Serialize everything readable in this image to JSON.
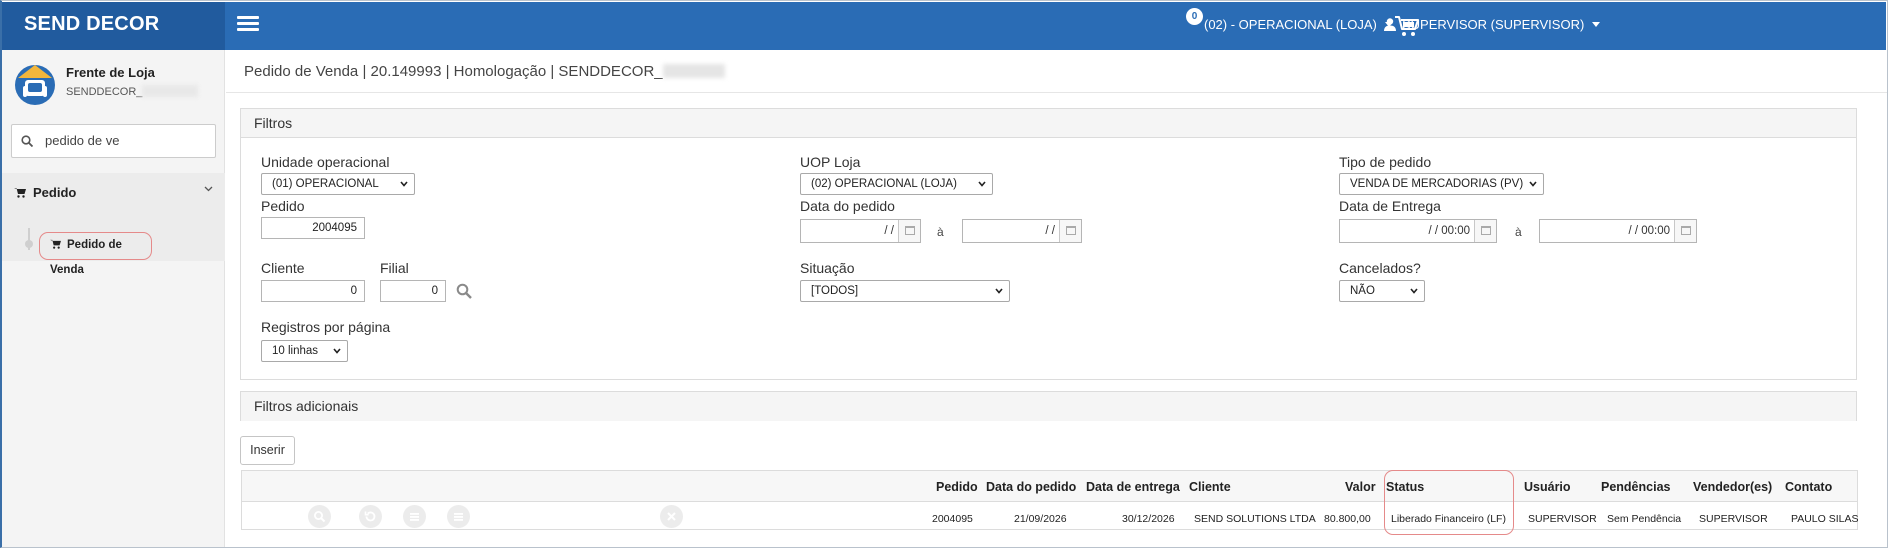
{
  "header": {
    "brand": "SEND DECOR",
    "cart_count": "0",
    "store_selector": "(02) - OPERACIONAL (LOJA)",
    "user_menu": "SUPERVISOR (SUPERVISOR)"
  },
  "sidebar": {
    "app_title": "Frente de Loja",
    "app_subtitle": "SENDDECOR_",
    "search_value": "pedido de ve",
    "menu_group": "Pedido",
    "menu_item": "Pedido de Venda"
  },
  "breadcrumb": "Pedido de Venda | 20.149993 | Homologação | SENDDECOR_",
  "filters": {
    "title": "Filtros",
    "unidade_label": "Unidade operacional",
    "unidade_value": "(01) OPERACIONAL",
    "uop_label": "UOP Loja",
    "uop_value": "(02) OPERACIONAL (LOJA)",
    "tipo_label": "Tipo de pedido",
    "tipo_value": "VENDA DE MERCADORIAS (PV)",
    "pedido_label": "Pedido",
    "pedido_value": "2004095",
    "data_pedido_label": "Data do pedido",
    "data_pedido_from": "/ /",
    "data_pedido_to": "/ /",
    "data_entrega_label": "Data de Entrega",
    "data_entrega_from": "/ /   00:00",
    "data_entrega_to": "/ /   00:00",
    "range_sep": "à",
    "cliente_label": "Cliente",
    "cliente_value": "0",
    "filial_label": "Filial",
    "filial_value": "0",
    "situacao_label": "Situação",
    "situacao_value": "[TODOS]",
    "cancelados_label": "Cancelados?",
    "cancelados_value": "NÃO",
    "registros_label": "Registros por página",
    "registros_value": "10 linhas"
  },
  "additional_filters": {
    "title": "Filtros adicionais"
  },
  "actions": {
    "insert_label": "Inserir"
  },
  "table": {
    "columns": [
      "Pedido",
      "Data do pedido",
      "Data de entrega",
      "Cliente",
      "Valor",
      "Status",
      "Usuário",
      "Pendências",
      "Vendedor(es)",
      "Contato"
    ],
    "rows": [
      [
        "2004095",
        "21/09/2026",
        "30/12/2026",
        "SEND SOLUTIONS LTDA",
        "80.800,00",
        "Liberado Financeiro (LF)",
        "SUPERVISOR",
        "Sem Pendência",
        "SUPERVISOR",
        "PAULO SILAS"
      ]
    ]
  },
  "colors": {
    "topbar": "#2a6cb5",
    "brand_bar": "#215b9e",
    "highlight": "#e58a8a"
  }
}
